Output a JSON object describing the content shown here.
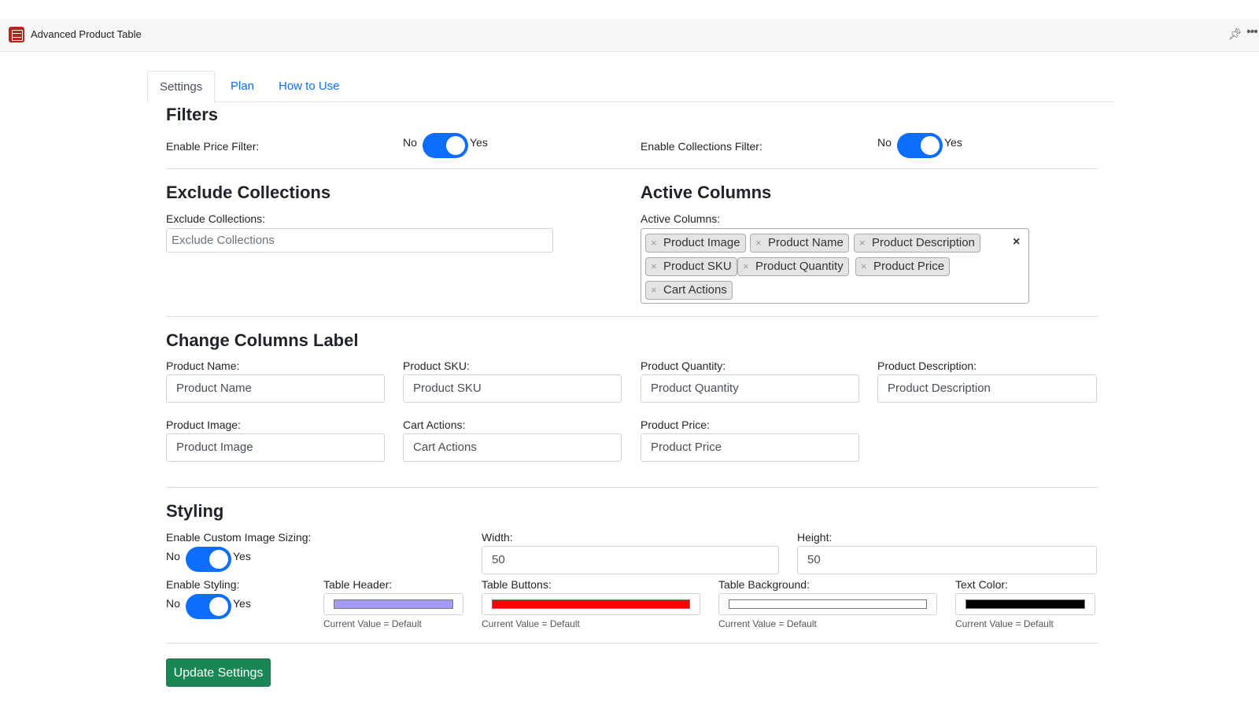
{
  "app": {
    "title": "Advanced Product Table",
    "icon": "table-app-icon"
  },
  "header_actions": {
    "pin": "pin-icon",
    "more": "more-options-icon"
  },
  "tabs": [
    {
      "label": "Settings",
      "active": true
    },
    {
      "label": "Plan",
      "active": false
    },
    {
      "label": "How to Use",
      "active": false
    }
  ],
  "filters": {
    "title": "Filters",
    "price_filter": {
      "label": "Enable Price Filter:",
      "no": "No",
      "yes": "Yes",
      "enabled": true
    },
    "collections_filter": {
      "label": "Enable Collections Filter:",
      "no": "No",
      "yes": "Yes",
      "enabled": true
    }
  },
  "exclude_collections": {
    "title": "Exclude Collections",
    "label": "Exclude Collections:",
    "placeholder": "Exclude Collections"
  },
  "active_columns": {
    "title": "Active Columns",
    "label": "Active Columns:",
    "tags": [
      "Product Image",
      "Product Name",
      "Product Description",
      "Product SKU",
      "Product Quantity",
      "Product Price",
      "Cart Actions"
    ],
    "remove_symbol": "×",
    "clear_symbol": "×"
  },
  "change_labels": {
    "title": "Change Columns Label",
    "fields": [
      {
        "label": "Product Name:",
        "value": "Product Name"
      },
      {
        "label": "Product SKU:",
        "value": "Product SKU"
      },
      {
        "label": "Product Quantity:",
        "value": "Product Quantity"
      },
      {
        "label": "Product Description:",
        "value": "Product Description"
      },
      {
        "label": "Product Image:",
        "value": "Product Image"
      },
      {
        "label": "Cart Actions:",
        "value": "Cart Actions"
      },
      {
        "label": "Product Price:",
        "value": "Product Price"
      }
    ]
  },
  "styling": {
    "title": "Styling",
    "image_sizing": {
      "label": "Enable Custom Image Sizing:",
      "no": "No",
      "yes": "Yes",
      "enabled": true
    },
    "width": {
      "label": "Width:",
      "value": "50"
    },
    "height": {
      "label": "Height:",
      "value": "50"
    },
    "enable_styling": {
      "label": "Enable Styling:",
      "no": "No",
      "yes": "Yes",
      "enabled": true
    },
    "colors": [
      {
        "label": "Table Header:",
        "color": "#a39af4",
        "note": "Current Value = Default"
      },
      {
        "label": "Table Buttons:",
        "color": "#ff0000",
        "note": "Current Value = Default"
      },
      {
        "label": "Table Background:",
        "color": "#ffffff",
        "note": "Current Value = Default"
      },
      {
        "label": "Text Color:",
        "color": "#000000",
        "note": "Current Value = Default"
      }
    ]
  },
  "submit": {
    "label": "Update Settings"
  },
  "theme": {
    "accent": "#0d6efd",
    "success": "#198754"
  }
}
